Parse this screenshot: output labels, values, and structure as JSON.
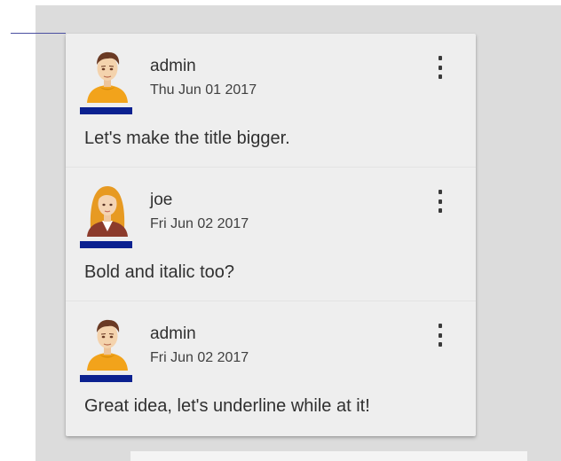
{
  "comments": [
    {
      "author": "admin",
      "date": "Thu Jun 01 2017",
      "text": "Let's make the title bigger.",
      "avatar_icon": "male-avatar-icon"
    },
    {
      "author": "joe",
      "date": "Fri Jun 02 2017",
      "text": "Bold and italic too?",
      "avatar_icon": "female-avatar-icon"
    },
    {
      "author": "admin",
      "date": "Fri Jun 02 2017",
      "text": "Great idea, let's underline while at it!",
      "avatar_icon": "male-avatar-icon"
    }
  ],
  "menu_icon": "more-vertical-icon",
  "colors": {
    "author_marker": "#0b2190",
    "card_background": "#eeeeee",
    "canvas_background": "#dcdcdc",
    "connector_line": "#4a4fa0"
  }
}
